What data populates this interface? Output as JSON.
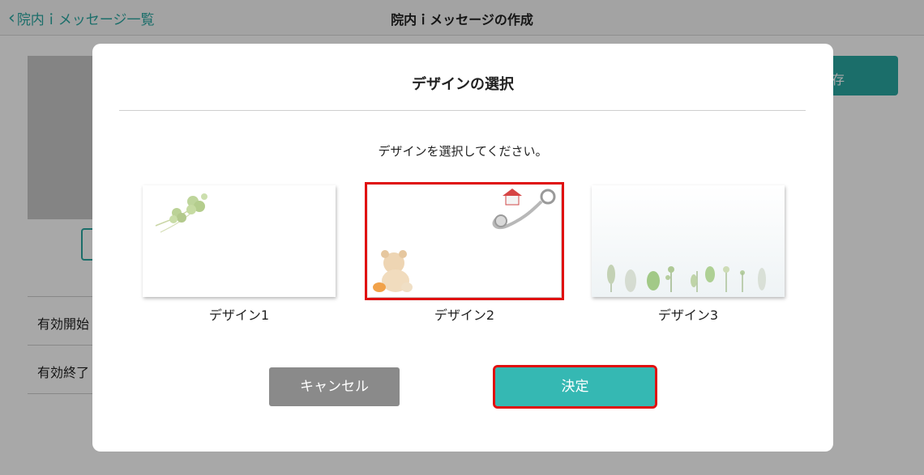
{
  "navbar": {
    "back_label": "院内ｉメッセージ一覧",
    "title": "院内ｉメッセージの作成"
  },
  "background": {
    "save_label": "存",
    "rows": [
      {
        "label": "有効開始"
      },
      {
        "label": "有効終了"
      }
    ]
  },
  "modal": {
    "title": "デザインの選択",
    "instruction": "デザインを選択してください。",
    "designs": [
      {
        "label": "デザイン1",
        "selected": false,
        "theme": "clover"
      },
      {
        "label": "デザイン2",
        "selected": true,
        "theme": "teddy-bear-stethoscope"
      },
      {
        "label": "デザイン3",
        "selected": false,
        "theme": "plants"
      }
    ],
    "cancel_label": "キャンセル",
    "confirm_label": "決定"
  },
  "colors": {
    "accent": "#35b8b3",
    "selection": "#e01010",
    "cancel": "#8a8a8a"
  }
}
